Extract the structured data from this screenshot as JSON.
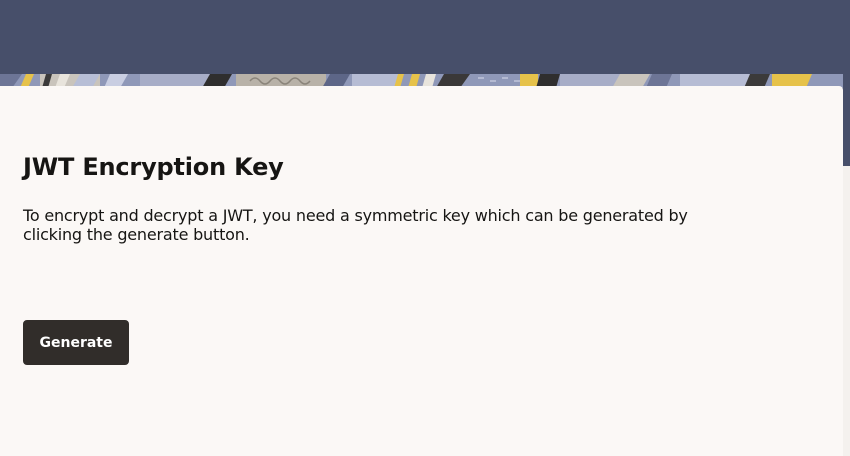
{
  "colors": {
    "header_background": "#474f6a",
    "panel_background": "#fbf8f6",
    "text": "#161513",
    "button_background": "#312d2a",
    "button_text": "#ffffff"
  },
  "main": {
    "title": "JWT Encryption Key",
    "description": "To encrypt and decrypt a JWT, you need a symmetric key which can be generated by clicking the generate button.",
    "generate_button_label": "Generate"
  }
}
